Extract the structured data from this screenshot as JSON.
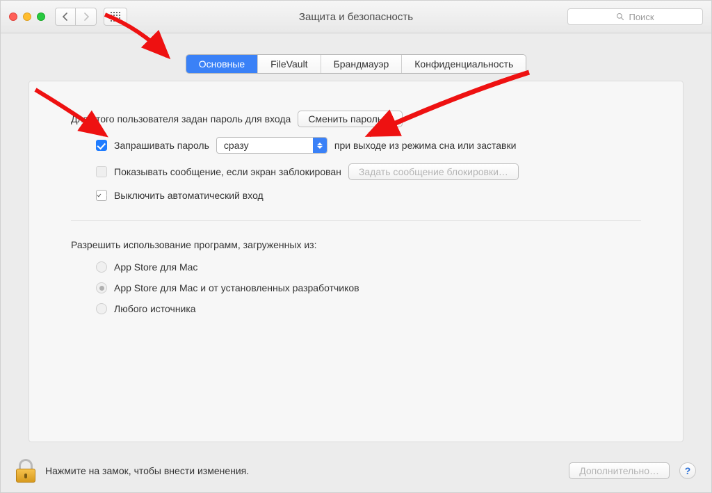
{
  "window": {
    "title": "Защита и безопасность",
    "search_placeholder": "Поиск"
  },
  "tabs": [
    {
      "label": "Основные",
      "active": true
    },
    {
      "label": "FileVault",
      "active": false
    },
    {
      "label": "Брандмауэр",
      "active": false
    },
    {
      "label": "Конфиденциальность",
      "active": false
    }
  ],
  "general": {
    "login_password_text": "Для этого пользователя задан пароль для входа",
    "change_password_btn": "Сменить пароль…",
    "require_password_label": "Запрашивать пароль",
    "require_password_delay": "сразу",
    "require_password_rest": "при выходе из режима сна или заставки",
    "show_message_label": "Показывать сообщение, если экран заблокирован",
    "set_lock_message_btn": "Задать сообщение блокировки…",
    "disable_auto_login_label": "Выключить автоматический вход"
  },
  "apps": {
    "section_label": "Разрешить использование программ, загруженных из:",
    "options": [
      {
        "label": "App Store для Mac",
        "selected": false
      },
      {
        "label": "App Store для Mac и от установленных разработчиков",
        "selected": true
      },
      {
        "label": "Любого источника",
        "selected": false
      }
    ]
  },
  "footer": {
    "lock_text": "Нажмите на замок, чтобы внести изменения.",
    "advanced_btn": "Дополнительно…",
    "help": "?"
  }
}
